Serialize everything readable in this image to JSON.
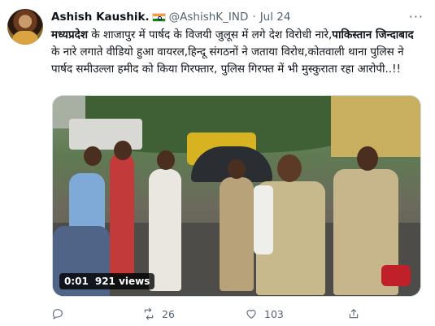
{
  "author": {
    "display_name": "Ashish Kaushik.",
    "handle": "@AshishK_IND",
    "separator": "·",
    "date": "Jul 24",
    "flag_icon": "india-flag-icon",
    "more_label": "···"
  },
  "tweet": {
    "segments": [
      {
        "text": "मध्यप्रदेश",
        "bold": true
      },
      {
        "text": " के शाजापुर में पार्षद के विजयी जुलूस में लगे देश विरोधी नारे,",
        "bold": false
      },
      {
        "text": "पाकिस्तान जिन्दाबाद",
        "bold": true
      },
      {
        "text": " के नारे लगाते वीडियो हुआ वायरल,हिन्दू संगठनों ने जताया विरोध,कोतवाली थाना पुलिस ने पार्षद समीउल्ला हमीद को किया गिरफ्तार, पुलिस गिरफ्त में भी मुस्कुराता रहा आरोपी..!!",
        "bold": false
      }
    ]
  },
  "media": {
    "duration": "0:01",
    "views": "921 views"
  },
  "actions": {
    "reply_count": "",
    "retweet_count": "26",
    "like_count": "103",
    "share_count": ""
  },
  "colors": {
    "text_primary": "#0f1419",
    "text_secondary": "#536471",
    "border": "#cfd9de"
  }
}
